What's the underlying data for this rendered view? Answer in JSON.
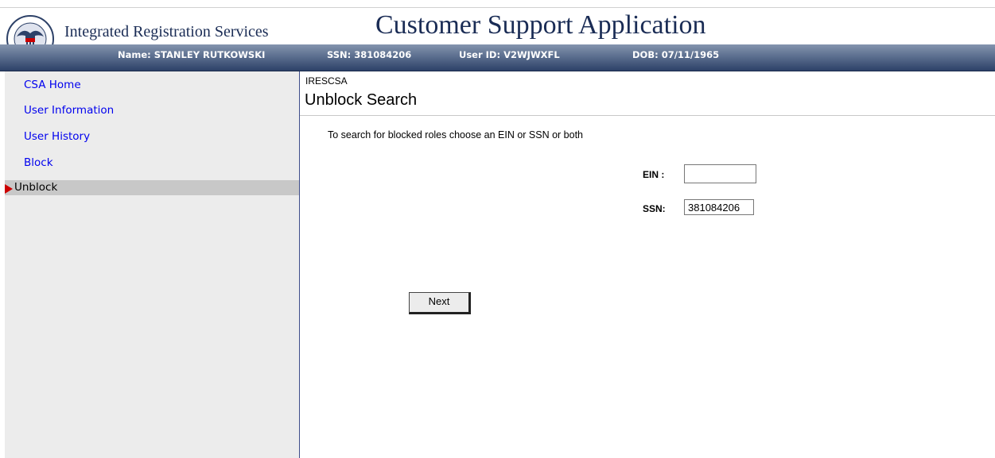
{
  "header": {
    "brand": "Integrated Registration Services",
    "app_title": "Customer Support Application",
    "logo_icon": "social-security-administration-seal-icon"
  },
  "user_bar": {
    "name": "Name: STANLEY RUTKOWSKI",
    "ssn": "SSN: 381084206",
    "user_id": "User ID: V2WJWXFL",
    "dob": "DOB: 07/11/1965"
  },
  "sidebar": {
    "items": [
      {
        "label": "CSA Home"
      },
      {
        "label": "User Information"
      },
      {
        "label": "User History"
      },
      {
        "label": "Block"
      },
      {
        "label": "Unblock",
        "active": true
      }
    ],
    "active_indicator_icon": "red-arrow-icon"
  },
  "main": {
    "breadcrumb": "IRESCSA",
    "title": "Unblock Search",
    "instructions": "To search for blocked roles choose an EIN or SSN or both",
    "ein": {
      "label": "EIN :",
      "value": ""
    },
    "ssn": {
      "label": "SSN:",
      "value": "381084206"
    },
    "next_label": "Next"
  },
  "colors": {
    "header_bar": "#5c6f8f",
    "link": "#0000ee",
    "active_arrow": "#cc0000",
    "sidebar_bg": "#ececec",
    "brand_text": "#1a2c55"
  }
}
